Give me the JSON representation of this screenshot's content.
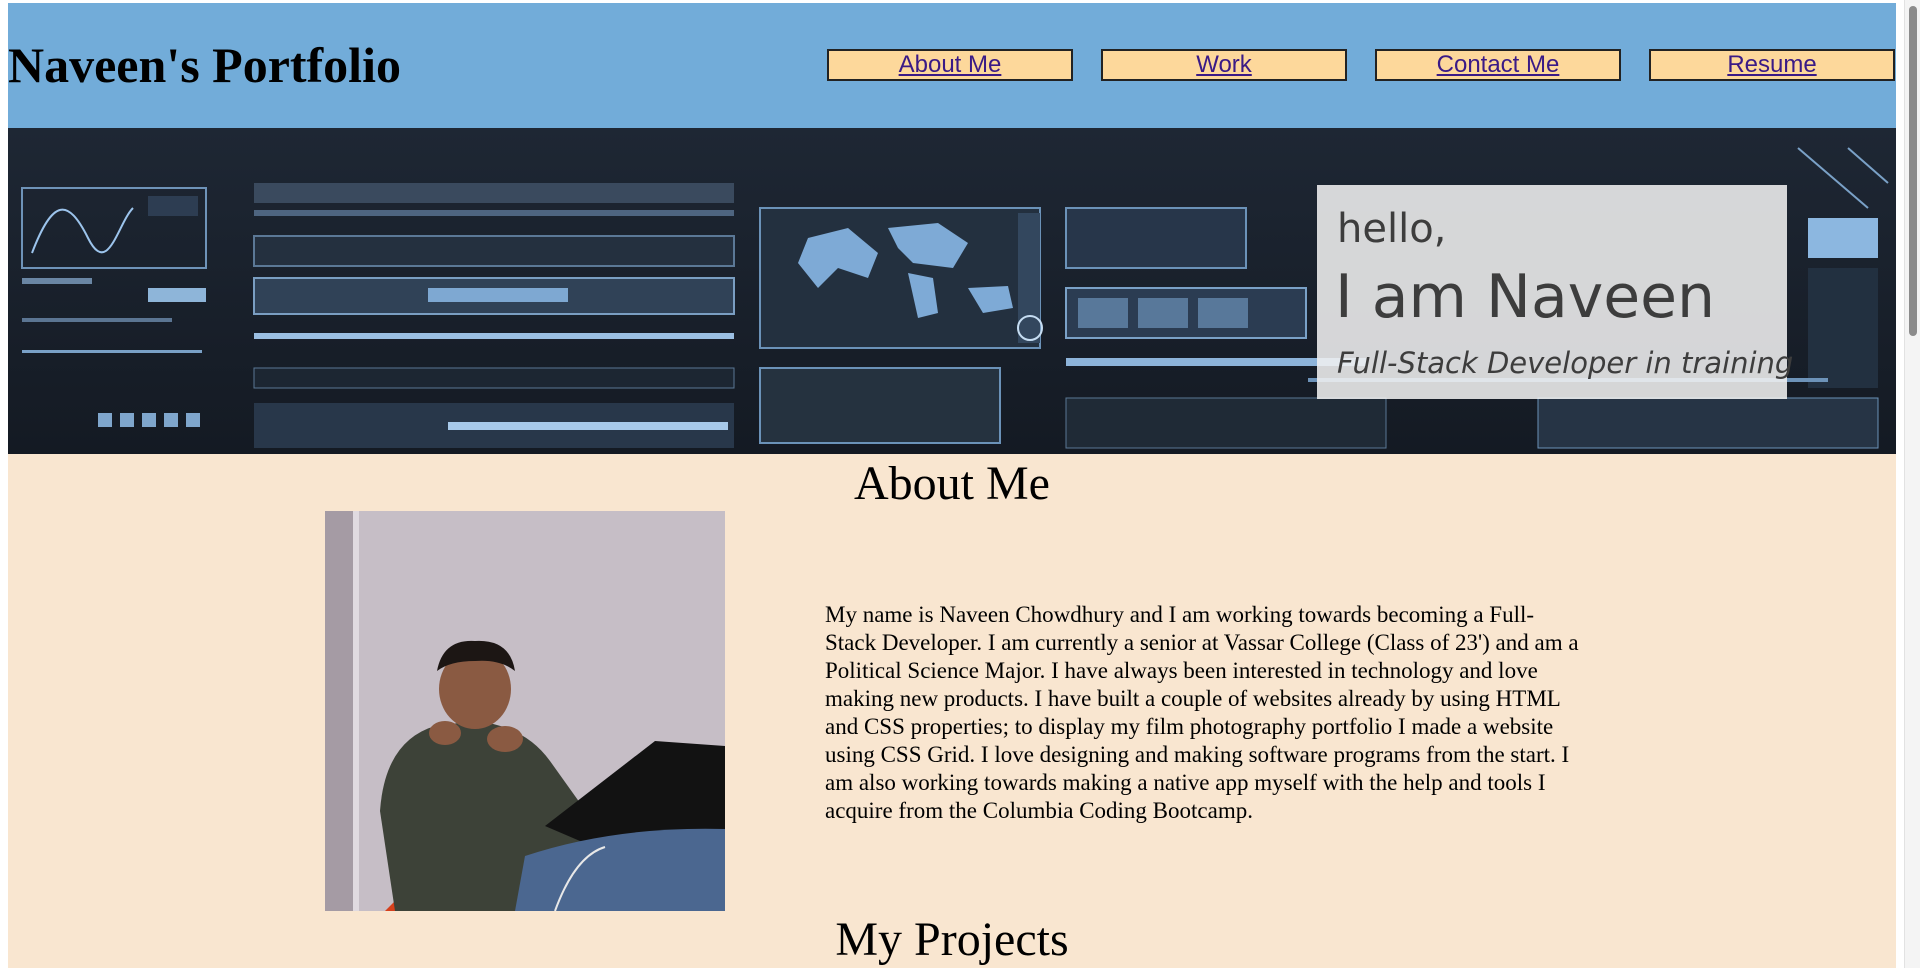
{
  "header": {
    "title": "Naveen's Portfolio",
    "nav": [
      "About Me",
      "Work",
      "Contact Me",
      "Resume"
    ]
  },
  "hero": {
    "greeting": "hello,",
    "name": "I am Naveen",
    "role": "Full-Stack Developer in training"
  },
  "about": {
    "heading": "About Me",
    "photo_icon": "portrait-photo",
    "bio": "My name is Naveen Chowdhury and I am working towards becoming a Full-Stack Developer. I am currently a senior at Vassar College (Class of 23') and am a Political Science Major. I have always been interested in technology and love making new products. I have built a couple of websites already by using HTML and CSS properties; to display my film photography portfolio I made a website using CSS Grid. I love designing and making software programs from the start. I am also working towards making a native app myself with the help and tools I acquire from the Columbia Coding Bootcamp."
  },
  "projects": {
    "heading": "My Projects"
  },
  "colors": {
    "header_bg": "#72acd9",
    "nav_bg": "#fdd89b",
    "link": "#3a1a86",
    "page_bg": "#f9e6d0"
  }
}
